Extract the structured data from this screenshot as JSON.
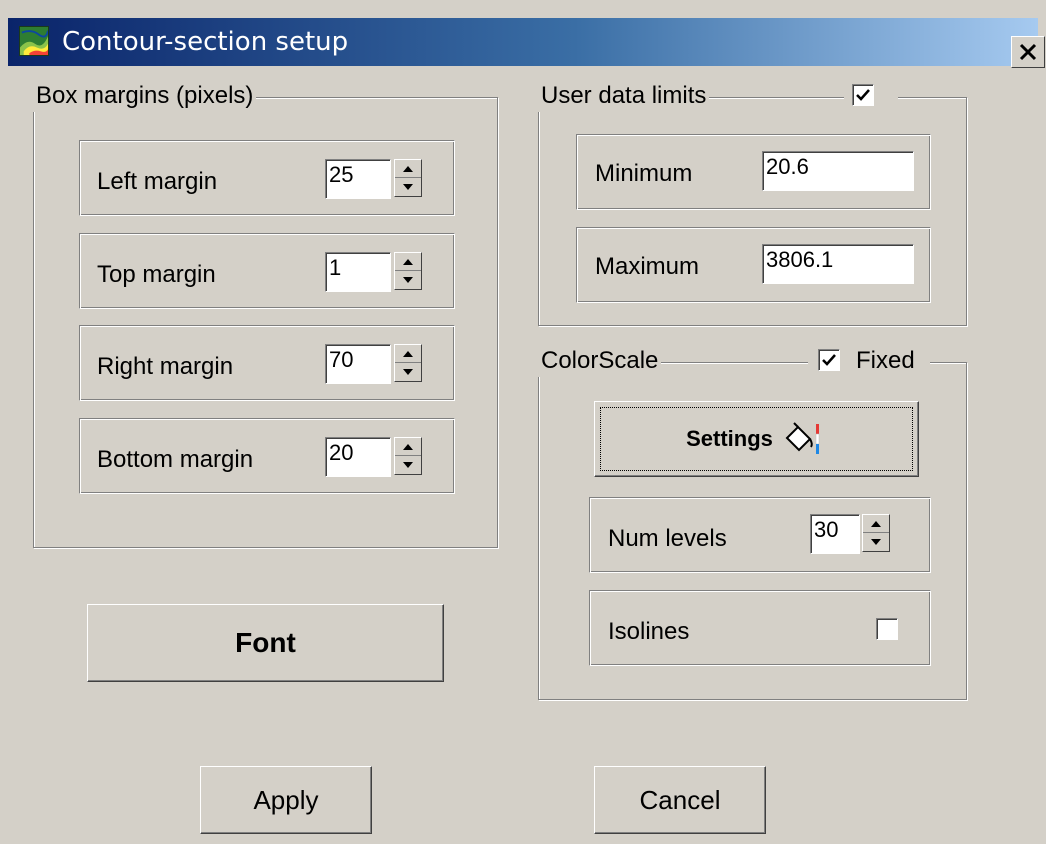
{
  "window": {
    "title": "Contour-section setup",
    "app_icon": "contour-map-icon",
    "close_icon": "close-x-icon",
    "title_gradient": [
      "#0a246a",
      "#a6caf0"
    ]
  },
  "box_margins": {
    "label": "Box margins (pixels)",
    "fields": [
      {
        "label": "Left margin",
        "value": "25"
      },
      {
        "label": "Top margin",
        "value": "1"
      },
      {
        "label": "Right margin",
        "value": "70"
      },
      {
        "label": "Bottom margin",
        "value": "20"
      }
    ]
  },
  "user_data_limits": {
    "label": "User data limits",
    "checked": true,
    "minimum": {
      "label": "Minimum",
      "value": "20.6"
    },
    "maximum": {
      "label": "Maximum",
      "value": "3806.1"
    }
  },
  "colorscale": {
    "label": "ColorScale",
    "fixed_label": "Fixed",
    "fixed_checked": true,
    "settings_label": "Settings",
    "settings_icon": "paint-bucket-icon",
    "num_levels": {
      "label": "Num levels",
      "value": "30"
    },
    "isolines": {
      "label": "Isolines",
      "checked": false
    }
  },
  "buttons": {
    "font": "Font",
    "apply": "Apply",
    "cancel": "Cancel"
  }
}
